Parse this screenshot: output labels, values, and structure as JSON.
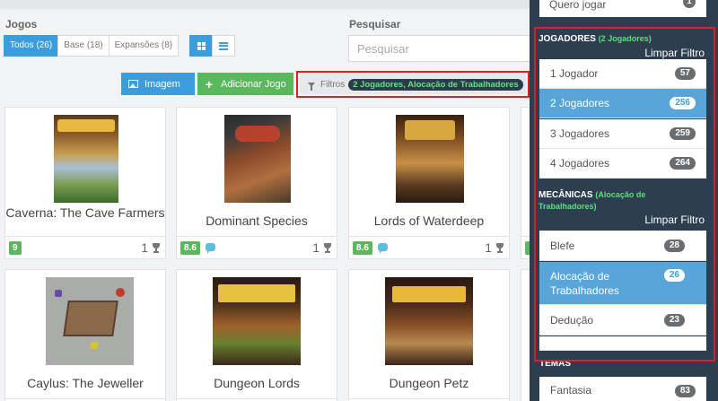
{
  "header": {
    "jogos_label": "Jogos",
    "search_label": "Pesquisar",
    "search_placeholder": "Pesquisar"
  },
  "type_filter": [
    {
      "label": "Todos (26)",
      "active": true
    },
    {
      "label": "Base (18)",
      "active": false
    },
    {
      "label": "Expansões (8)",
      "active": false
    }
  ],
  "view_toggle": [
    {
      "icon": "grid-icon",
      "active": true
    },
    {
      "icon": "list-icon",
      "active": false
    }
  ],
  "actions": {
    "image_label": "Imagem",
    "add_label": "Adicionar Jogo"
  },
  "filter_bar": {
    "label": "Filtros",
    "active_filters": "2 Jogadores, Alocação de Trabalhadores"
  },
  "games": [
    {
      "name": "Caverna: The Cave Farmers",
      "score": "9",
      "has_comments": false,
      "wins": "1"
    },
    {
      "name": "Dominant Species",
      "score": "8.6",
      "has_comments": true,
      "wins": "1"
    },
    {
      "name": "Lords of Waterdeep",
      "score": "8.6",
      "has_comments": true,
      "wins": "1"
    },
    {
      "name": "Caylus: The Jeweller"
    },
    {
      "name": "Dungeon Lords"
    },
    {
      "name": "Dungeon Petz"
    }
  ],
  "panel": {
    "previous_item": {
      "label": "Quero jogar",
      "count": "1"
    },
    "players": {
      "title": "JOGADORES",
      "selected": "(2 Jogadores)",
      "clear_label": "Limpar Filtro",
      "items": [
        {
          "label": "1 Jogador",
          "count": "57",
          "active": false
        },
        {
          "label": "2 Jogadores",
          "count": "256",
          "active": true
        },
        {
          "label": "3 Jogadores",
          "count": "259",
          "active": false
        },
        {
          "label": "4 Jogadores",
          "count": "264",
          "active": false
        }
      ]
    },
    "mechanics": {
      "title": "MECÂNICAS",
      "selected": "(Alocação de Trabalhadores)",
      "clear_label": "Limpar Filtro",
      "items": [
        {
          "label": "Blefe",
          "count": "28",
          "active": false
        },
        {
          "label": "Alocação de Trabalhadores",
          "count": "26",
          "active": true
        },
        {
          "label": "Dedução",
          "count": "23",
          "active": false
        }
      ]
    },
    "themes": {
      "title": "TEMAS",
      "items": [
        {
          "label": "Fantasia",
          "count": "83"
        }
      ]
    }
  },
  "colors": {
    "primary": "#3b9ddd",
    "success": "#5cb85c",
    "panel_bg": "#2c3e50",
    "highlight_red": "#e02020",
    "filter_badge_text": "#66e088"
  }
}
